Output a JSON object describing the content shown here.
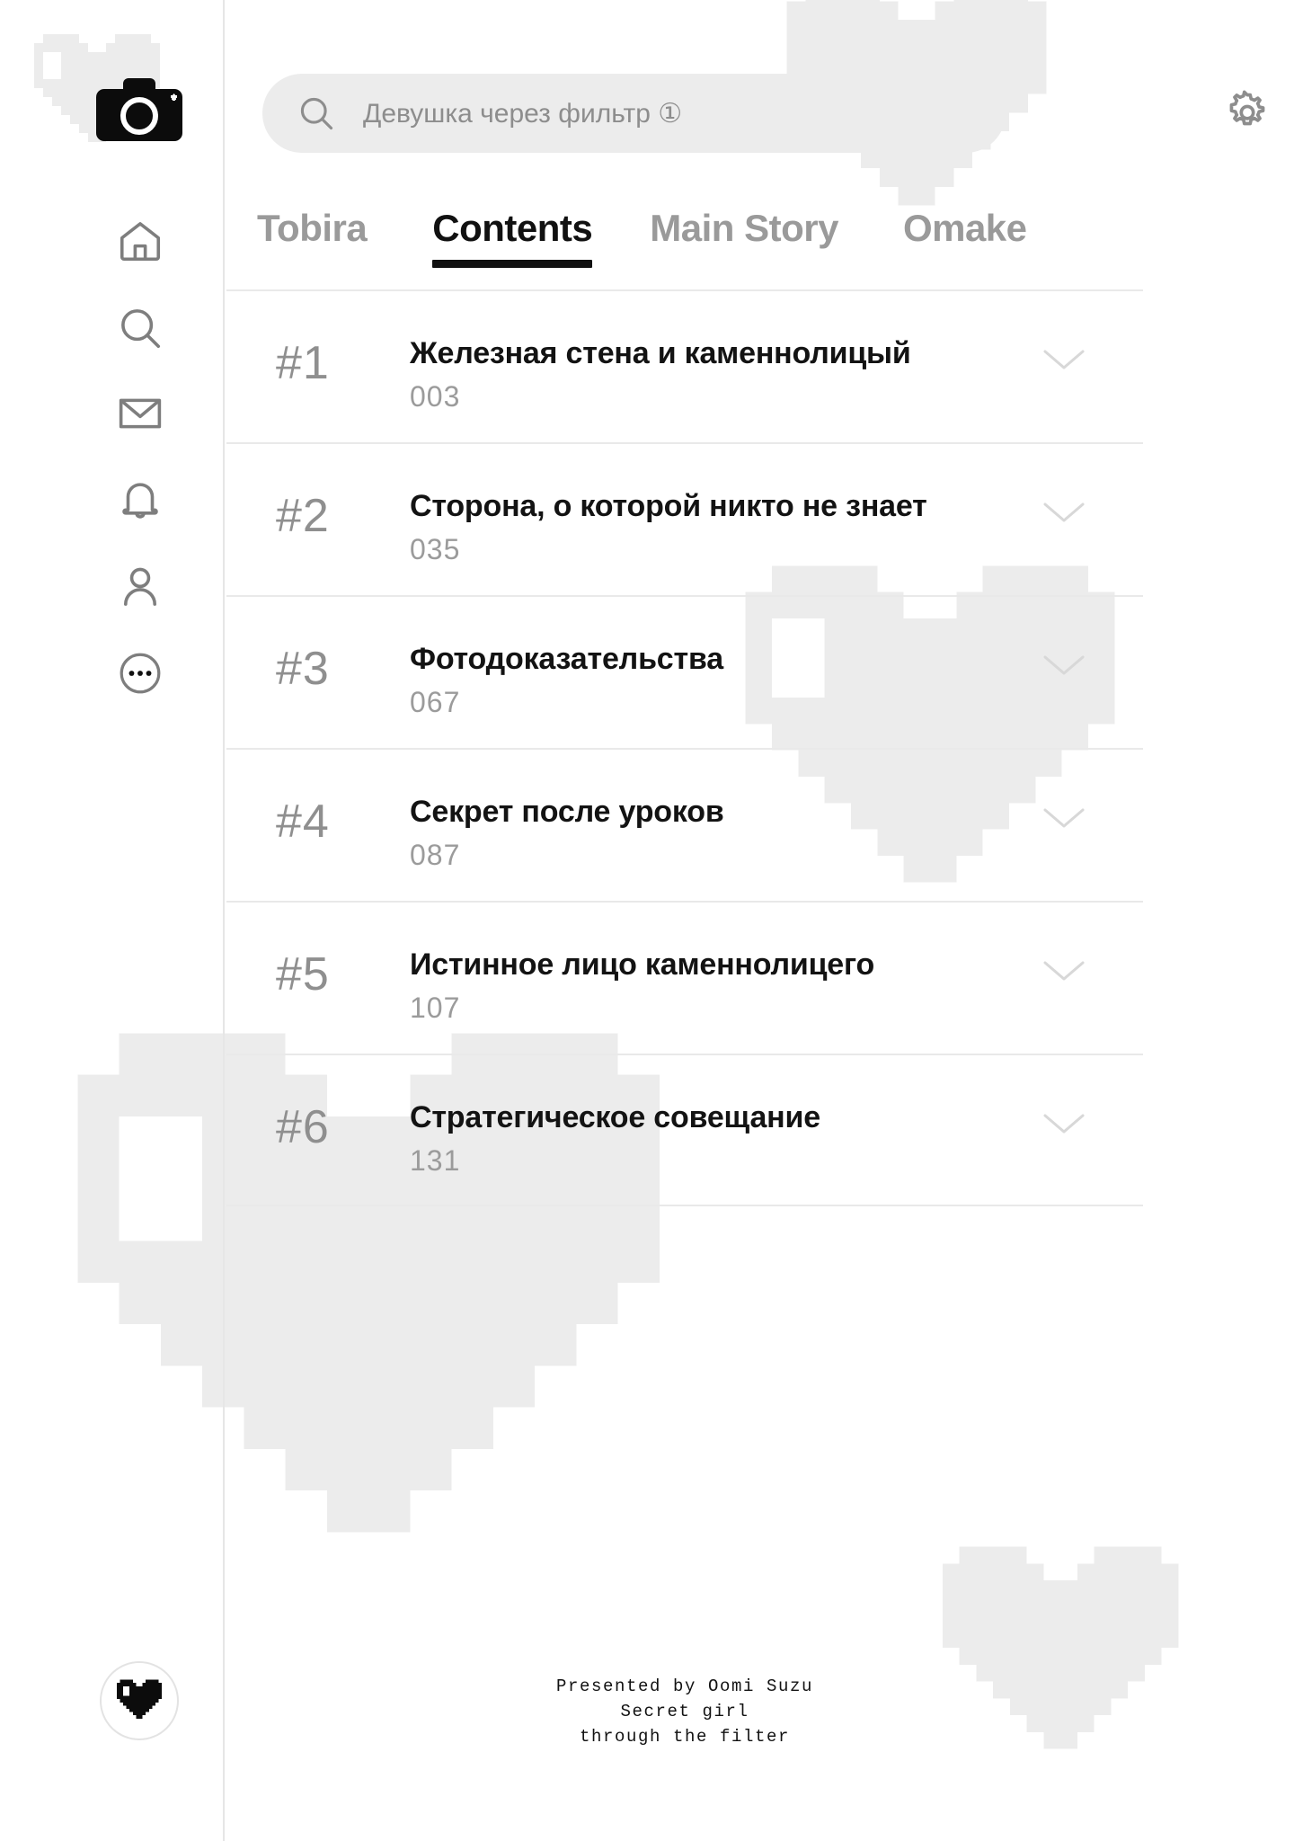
{
  "app": {
    "logo_icon": "camera-icon",
    "accent_color": "#111111",
    "muted_color": "#9a9a9a",
    "search_bg": "#ececec",
    "divider_color": "#e9e9e9",
    "deco_color": "#ececec"
  },
  "sidebar": {
    "logo": {
      "icon": "camera-icon",
      "label": ""
    },
    "items": [
      {
        "icon": "home-icon",
        "label": ""
      },
      {
        "icon": "search-icon",
        "label": ""
      },
      {
        "icon": "mail-icon",
        "label": ""
      },
      {
        "icon": "bell-icon",
        "label": ""
      },
      {
        "icon": "person-icon",
        "label": ""
      },
      {
        "icon": "more-ellipsis-icon",
        "label": ""
      }
    ],
    "badge": {
      "icon": "pixel-heart-icon",
      "label": ""
    }
  },
  "search": {
    "icon": "search-icon",
    "value": "Девушка через фильтр ①",
    "placeholder": "Девушка через фильтр ①"
  },
  "settings_button": {
    "icon": "gear-icon",
    "label": ""
  },
  "tabs": [
    {
      "label": "Tobira",
      "active": false
    },
    {
      "label": "Contents",
      "active": true
    },
    {
      "label": "Main Story",
      "active": false
    },
    {
      "label": "Omake",
      "active": false
    }
  ],
  "contents": [
    {
      "number": "#1",
      "title": "Железная стена и каменнолицый",
      "page": "003",
      "chevron": "chevron-down-icon"
    },
    {
      "number": "#2",
      "title": "Сторона, о которой никто не знает",
      "page": "035",
      "chevron": "chevron-down-icon"
    },
    {
      "number": "#3",
      "title": "Фотодоказательства",
      "page": "067",
      "chevron": "chevron-down-icon"
    },
    {
      "number": "#4",
      "title": "Секрет после уроков",
      "page": "087",
      "chevron": "chevron-down-icon"
    },
    {
      "number": "#5",
      "title": "Истинное лицо каменнолицего",
      "page": "107",
      "chevron": "chevron-down-icon"
    },
    {
      "number": "#6",
      "title": "Стратегическое совещание",
      "page": "131",
      "chevron": "chevron-down-icon"
    }
  ],
  "credit": {
    "line1": "Presented by Oomi Suzu",
    "line2": "Secret girl",
    "line3": "through the filter"
  }
}
